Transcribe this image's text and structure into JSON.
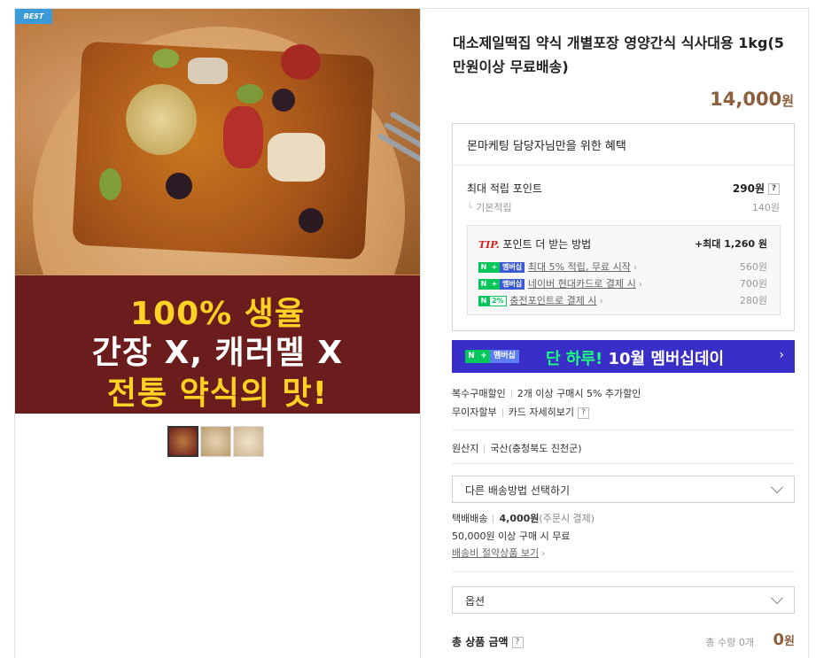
{
  "badge": "BEST",
  "banner": {
    "line1": "100% 생율",
    "line2": "간장 X, 캐러멜 X",
    "line3": "전통 약식의 맛!"
  },
  "product": {
    "title": "대소제일떡집 약식 개별포장 영양간식 식사대용 1kg(5만원이상 무료배송)",
    "price": "14,000",
    "price_unit": "원"
  },
  "benefit": {
    "header": "몬마케팅 담당자님만을 위한 혜택",
    "max_points_label": "최대 적립 포인트",
    "max_points_value": "290원",
    "qmark": "?",
    "basic_label": "기본적립",
    "basic_value": "140원",
    "tip_prefix": "TIP.",
    "tip_title": "포인트 더 받는 방법",
    "tip_max": "+최대 1,260 원",
    "items": [
      {
        "badge_n": "N",
        "badge_plus": "+",
        "badge_text": "멤버십",
        "label": "최대 5% 적립, 무료 시작",
        "value": "560원"
      },
      {
        "badge_n": "N",
        "badge_plus": "+",
        "badge_text": "멤버십",
        "label": "네이버 현대카드로 결제 시",
        "value": "700원"
      },
      {
        "badge_n": "N",
        "badge_plus": "2%",
        "badge_text": "",
        "label": "충전포인트로 결제 시",
        "value": "280원"
      }
    ]
  },
  "membership": {
    "n": "N",
    "plus": "+",
    "label": "멤버십",
    "text_hi": "단 하루!",
    "text": "10월 멤버십데이",
    "arrow": "›"
  },
  "discounts": {
    "multi_label": "복수구매할인",
    "multi_value": "2개 이상 구매시 5% 추가할인",
    "installment_label": "무이자할부",
    "installment_value": "카드 자세히보기"
  },
  "origin": {
    "label": "원산지",
    "value": "국산(충청북도 진천군)"
  },
  "shipping": {
    "select_label": "다른 배송방법 선택하기",
    "method": "택배배송",
    "fee": "4,000원",
    "fee_note": "(주문시 결제)",
    "free_condition": "50,000원 이상 구매 시 무료",
    "saving_link": "배송비 절약상품 보기"
  },
  "option": {
    "select_label": "옵션"
  },
  "total": {
    "label": "총 상품 금액",
    "qty": "총 수량 0개",
    "amount": "0",
    "unit": "원"
  }
}
